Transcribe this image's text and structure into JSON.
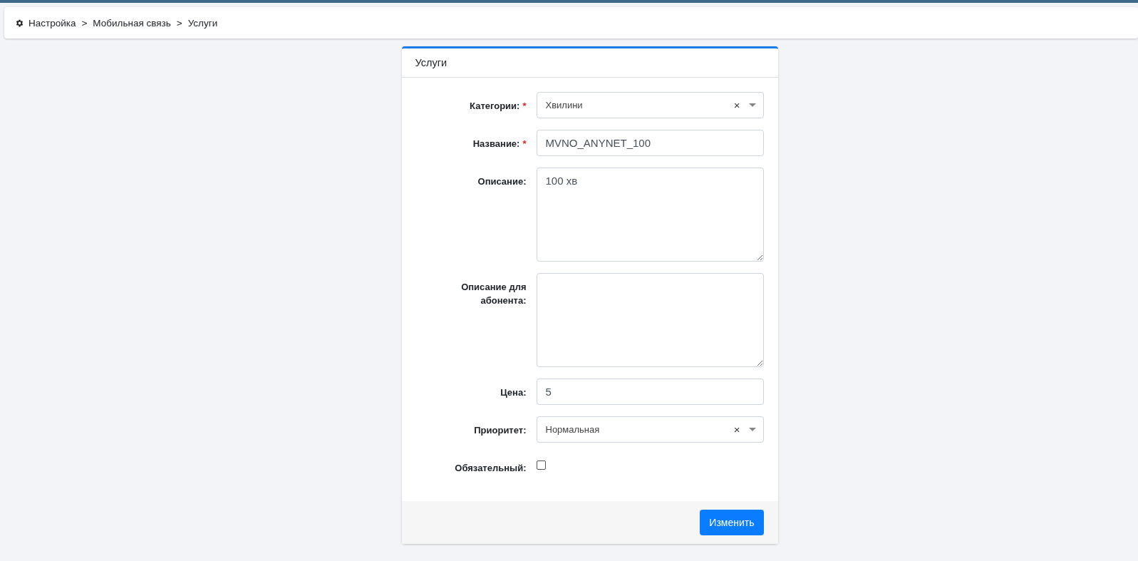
{
  "breadcrumb": [
    "Настройка",
    "Мобильная связь",
    "Услуги"
  ],
  "breadcrumb_separator": ">",
  "card": {
    "title": "Услуги",
    "fields": [
      {
        "kind": "select",
        "label": "Категории:",
        "required": true,
        "value": "Хвилини",
        "clear": "×"
      },
      {
        "kind": "input",
        "label": "Название:",
        "required": true,
        "value": "MVNO_ANYNET_100"
      },
      {
        "kind": "textarea",
        "label": "Описание:",
        "required": false,
        "value": "100 хв"
      },
      {
        "kind": "textarea",
        "label": "Описание для абонента:",
        "required": false
      },
      {
        "kind": "input",
        "label": "Цена:",
        "required": false,
        "value": "5"
      },
      {
        "kind": "select",
        "label": "Приоритет:",
        "required": false,
        "value": "Нормальная",
        "clear": "×"
      },
      {
        "kind": "checkbox",
        "label": "Обязательный:",
        "required": false,
        "checked": false
      }
    ],
    "required_mark": "*",
    "submit": "Изменить"
  }
}
